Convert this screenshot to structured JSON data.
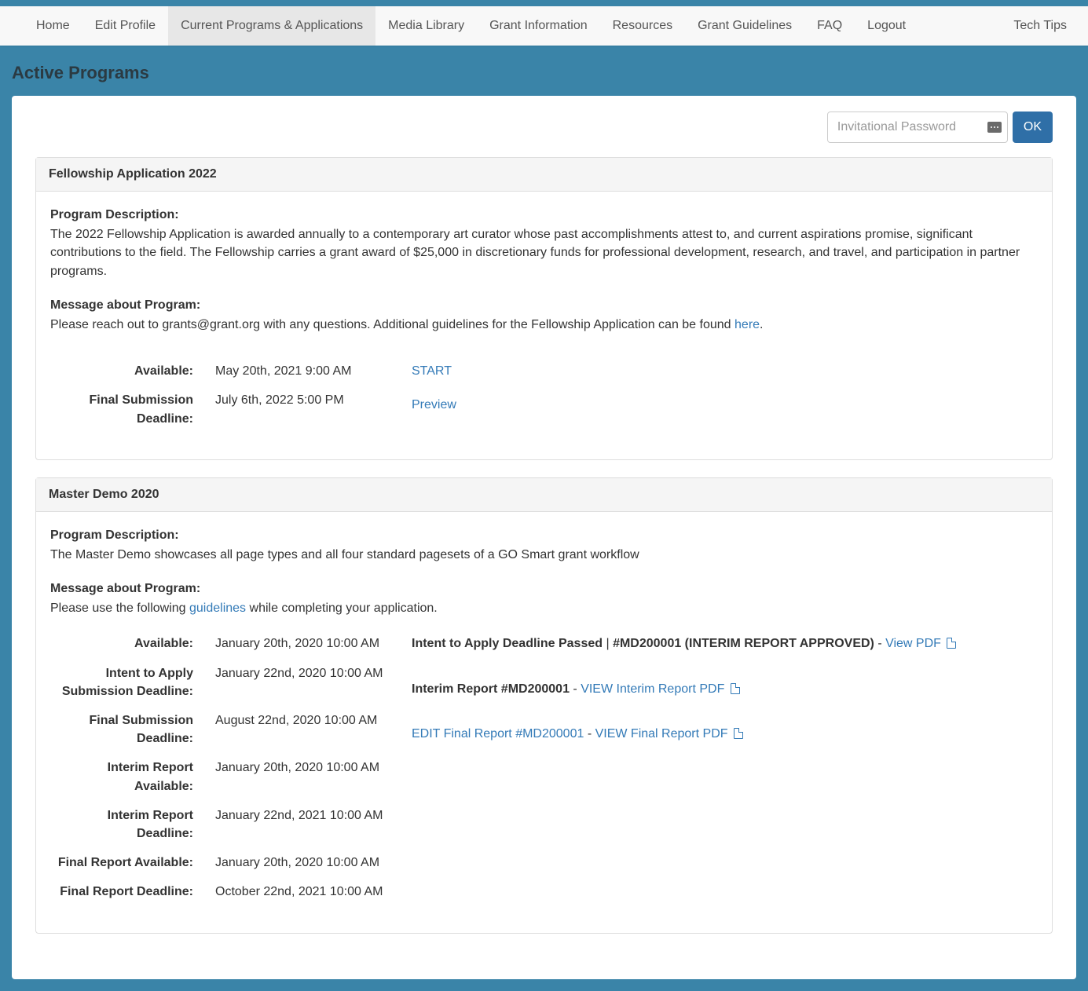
{
  "nav": {
    "items": [
      {
        "label": "Home"
      },
      {
        "label": "Edit Profile"
      },
      {
        "label": "Current Programs & Applications",
        "active": true
      },
      {
        "label": "Media Library"
      },
      {
        "label": "Grant Information"
      },
      {
        "label": "Resources"
      },
      {
        "label": "Grant Guidelines"
      },
      {
        "label": "FAQ"
      },
      {
        "label": "Logout"
      }
    ],
    "right": "Tech Tips"
  },
  "page": {
    "title": "Active Programs",
    "invitational_placeholder": "Invitational Password",
    "ok": "OK"
  },
  "programs": [
    {
      "title": "Fellowship Application 2022",
      "desc_label": "Program Description:",
      "desc": "The 2022 Fellowship Application is awarded annually to a contemporary art curator whose past accomplishments attest to, and current aspirations promise, significant contributions to the field. The Fellowship carries a grant award of $25,000 in discretionary funds for professional development, research, and travel, and participation in partner programs.",
      "msg_label": "Message about Program:",
      "msg_prefix": "Please reach out to grants@grant.org with any questions. Additional guidelines for the Fellowship Application can be found ",
      "msg_link": "here",
      "msg_suffix": ".",
      "dates": [
        {
          "label": "Available:",
          "value": "May 20th, 2021 9:00 AM"
        },
        {
          "label": "Final Submission Deadline:",
          "value": "July 6th, 2022 5:00 PM"
        }
      ],
      "actions_simple": [
        {
          "label": "START"
        },
        {
          "label": "Preview"
        }
      ]
    },
    {
      "title": "Master Demo 2020",
      "desc_label": "Program Description:",
      "desc": "The Master Demo showcases all page types and all four standard pagesets of a GO Smart grant workflow",
      "msg_label": "Message about Program:",
      "msg_prefix": "Please use the following ",
      "msg_link": "guidelines",
      "msg_suffix": " while completing your application.",
      "dates": [
        {
          "label": "Available:",
          "value": "January 20th, 2020 10:00 AM"
        },
        {
          "label": "Intent to Apply Submission Deadline:",
          "value": "January 22nd, 2020 10:00 AM"
        },
        {
          "label": "Final Submission Deadline:",
          "value": "August 22nd, 2020 10:00 AM"
        },
        {
          "label": "Interim Report Available:",
          "value": "January 20th, 2020 10:00 AM"
        },
        {
          "label": "Interim Report Deadline:",
          "value": "January 22nd, 2021 10:00 AM"
        },
        {
          "label": "Final Report Available:",
          "value": "January 20th, 2020 10:00 AM"
        },
        {
          "label": "Final Report Deadline:",
          "value": "October 22nd, 2021 10:00 AM"
        }
      ],
      "status": {
        "line1_a": "Intent to Apply Deadline Passed",
        "line1_sep": " | ",
        "line1_b": "#MD200001 (INTERIM REPORT APPROVED)",
        "line1_dash": " - ",
        "line1_link": "View PDF",
        "line2_a": "Interim Report #MD200001",
        "line2_dash": " - ",
        "line2_link": "VIEW Interim Report PDF",
        "line3_link1": "EDIT Final Report #MD200001",
        "line3_dash": " - ",
        "line3_link2": "VIEW Final Report PDF"
      }
    }
  ]
}
